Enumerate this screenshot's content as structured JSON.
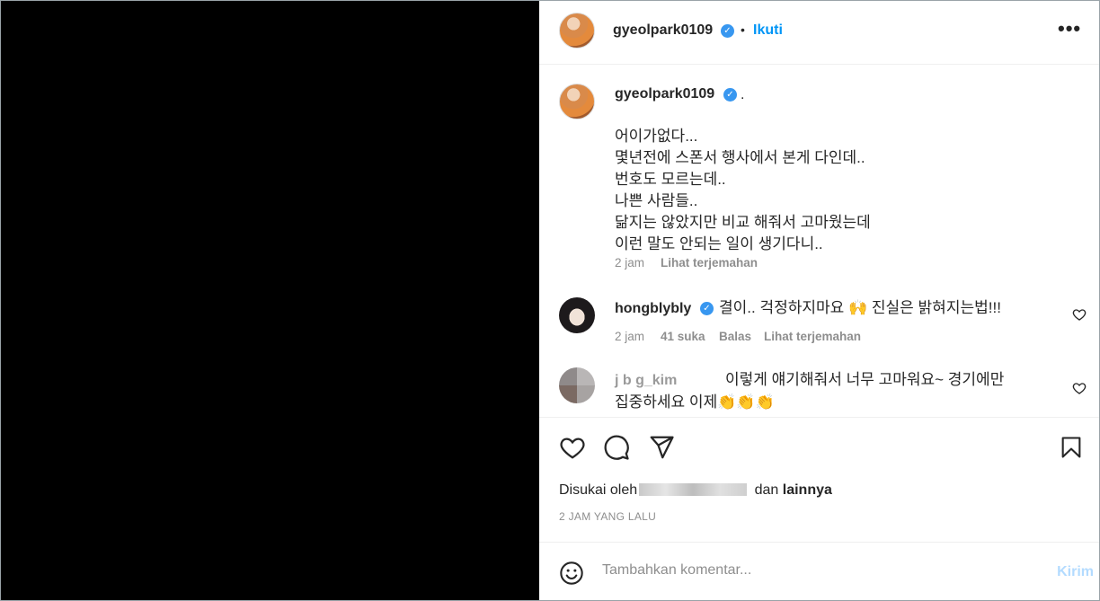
{
  "post": {
    "username": "gyeolpark0109",
    "follow_label": "Ikuti",
    "separator": "•",
    "more_label": "•••"
  },
  "caption": {
    "username": "gyeolpark0109",
    "suffix": ".",
    "text": "어이가없다...\n몇년전에 스폰서 행사에서 본게 다인데..\n번호도 모르는데..\n나쁜 사람들..\n닮지는 않았지만 비교 해줘서 고마웠는데\n이런 말도 안되는 일이 생기다니..",
    "time": "2 jam",
    "translate": "Lihat terjemahan"
  },
  "comments": [
    {
      "username": "hongblybly",
      "text": "결이.. 걱정하지마요 🙌 진실은 밝혀지는법!!!",
      "time": "2 jam",
      "likes": "41 suka",
      "reply": "Balas",
      "translate": "Lihat terjemahan"
    },
    {
      "username": "j  b   g_kim",
      "text_line1": "이렇게 얘기해줘서 너무 고마워요~ 경기에만",
      "text_line2": "집중하세요 이제👏👏👏"
    }
  ],
  "likes_line": {
    "prefix": "Disukai oleh",
    "blurred": "jj___ __p_____",
    "middle": "dan",
    "suffix": "lainnya"
  },
  "timestamp": "2 JAM YANG LALU",
  "comment_box": {
    "placeholder": "Tambahkan komentar...",
    "send_label": "Kirim"
  }
}
